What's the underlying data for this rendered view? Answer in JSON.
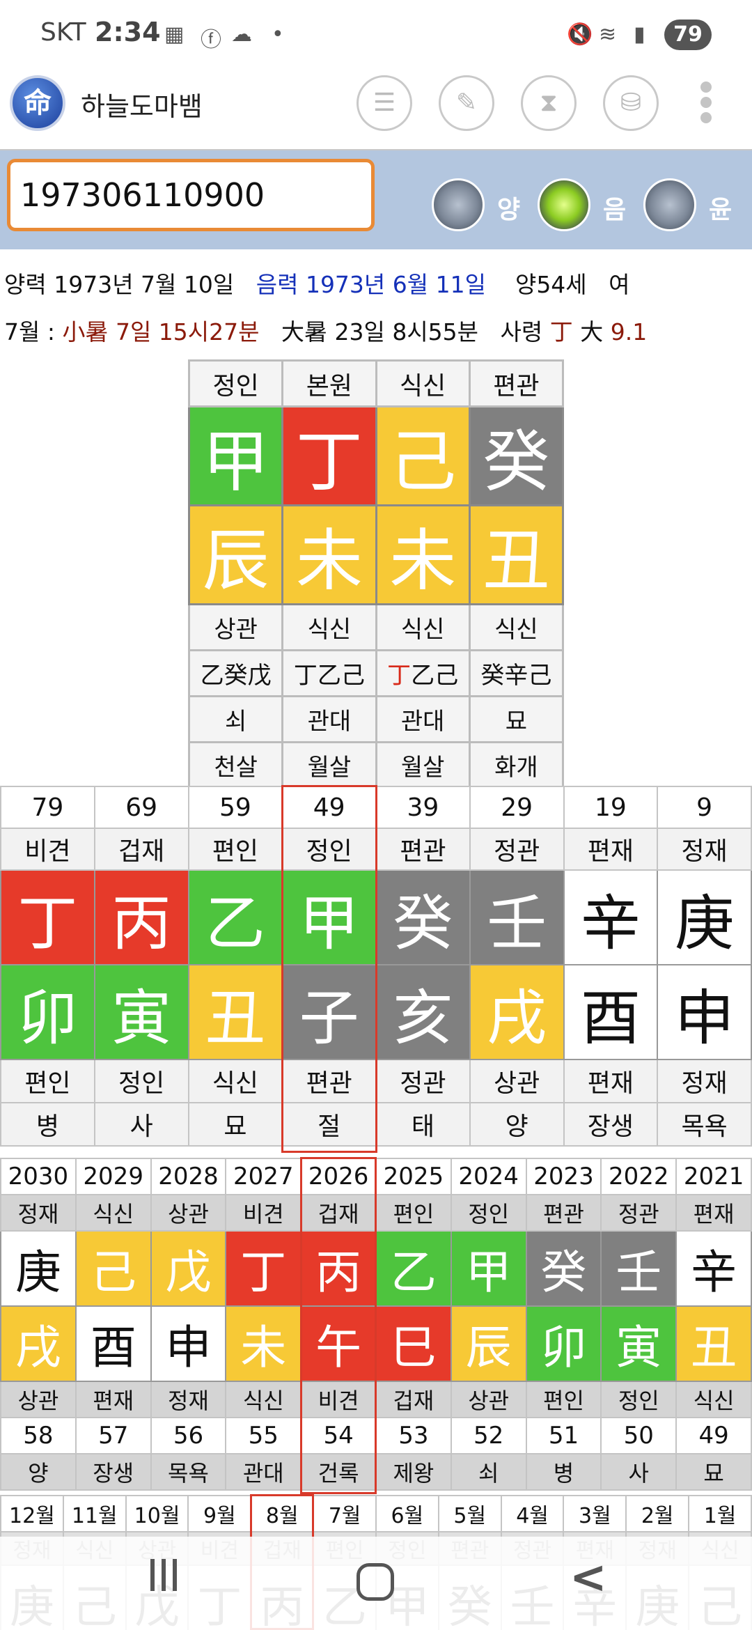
{
  "status_bar": {
    "carrier": "SKT",
    "time": "2:34",
    "battery": "79"
  },
  "app": {
    "title": "하늘도마뱀",
    "logo": "命",
    "toolbar_icons": [
      "list-icon",
      "edit-icon",
      "hourglass-icon",
      "database-icon",
      "more-icon"
    ]
  },
  "input": {
    "value": "197306110900",
    "radios": [
      {
        "label": "양",
        "selected": false
      },
      {
        "label": "음",
        "selected": true
      },
      {
        "label": "윤",
        "selected": false
      }
    ]
  },
  "info": {
    "solar": "양력 1973년 7월 10일",
    "lunar": "음력 1973년 6월 11일",
    "age": "양54세",
    "gender": "여",
    "month_prefix": "7월 :",
    "term1": "小暑 7일 15시27분",
    "term2": "大暑 23일 8시55분",
    "saryeong_label": "사령",
    "saryeong_char": "丁",
    "daeun_label": "大",
    "daeun_num": "9.1"
  },
  "saju": {
    "top_labels": [
      "정인",
      "본원",
      "식신",
      "편관"
    ],
    "stems": [
      {
        "char": "甲",
        "el": "wood"
      },
      {
        "char": "丁",
        "el": "fire"
      },
      {
        "char": "己",
        "el": "earth"
      },
      {
        "char": "癸",
        "el": "water"
      }
    ],
    "branches": [
      {
        "char": "辰",
        "el": "earth"
      },
      {
        "char": "未",
        "el": "earth"
      },
      {
        "char": "未",
        "el": "earth"
      },
      {
        "char": "丑",
        "el": "earth"
      }
    ],
    "branch_labels": [
      "상관",
      "식신",
      "식신",
      "식신"
    ],
    "hidden_stems": [
      {
        "red": "",
        "text": "乙癸戊"
      },
      {
        "red": "",
        "text": "丁乙己"
      },
      {
        "red": "丁",
        "text": "乙己"
      },
      {
        "red": "",
        "text": "癸辛己"
      }
    ],
    "stages": [
      "쇠",
      "관대",
      "관대",
      "묘"
    ],
    "spirits": [
      "천살",
      "월살",
      "월살",
      "화개"
    ]
  },
  "daeun": {
    "ages": [
      "79",
      "69",
      "59",
      "49",
      "39",
      "29",
      "19",
      "9"
    ],
    "stem_labels": [
      "비견",
      "겁재",
      "편인",
      "정인",
      "편관",
      "정관",
      "편재",
      "정재"
    ],
    "stems": [
      {
        "char": "丁",
        "el": "fire"
      },
      {
        "char": "丙",
        "el": "fire"
      },
      {
        "char": "乙",
        "el": "wood"
      },
      {
        "char": "甲",
        "el": "wood"
      },
      {
        "char": "癸",
        "el": "water"
      },
      {
        "char": "壬",
        "el": "water"
      },
      {
        "char": "辛",
        "el": "metal"
      },
      {
        "char": "庚",
        "el": "metal"
      }
    ],
    "branches": [
      {
        "char": "卯",
        "el": "wood"
      },
      {
        "char": "寅",
        "el": "wood"
      },
      {
        "char": "丑",
        "el": "earth"
      },
      {
        "char": "子",
        "el": "water"
      },
      {
        "char": "亥",
        "el": "water"
      },
      {
        "char": "戌",
        "el": "earth"
      },
      {
        "char": "酉",
        "el": "metal"
      },
      {
        "char": "申",
        "el": "metal"
      }
    ],
    "branch_labels": [
      "편인",
      "정인",
      "식신",
      "편관",
      "정관",
      "상관",
      "편재",
      "정재"
    ],
    "stages": [
      "병",
      "사",
      "묘",
      "절",
      "태",
      "양",
      "장생",
      "목욕"
    ]
  },
  "seun": {
    "years": [
      "2030",
      "2029",
      "2028",
      "2027",
      "2026",
      "2025",
      "2024",
      "2023",
      "2022",
      "2021"
    ],
    "stem_labels": [
      "정재",
      "식신",
      "상관",
      "비견",
      "겁재",
      "편인",
      "정인",
      "편관",
      "정관",
      "편재"
    ],
    "stems": [
      {
        "char": "庚",
        "el": "metal"
      },
      {
        "char": "己",
        "el": "earth"
      },
      {
        "char": "戊",
        "el": "earth"
      },
      {
        "char": "丁",
        "el": "fire"
      },
      {
        "char": "丙",
        "el": "fire"
      },
      {
        "char": "乙",
        "el": "wood"
      },
      {
        "char": "甲",
        "el": "wood"
      },
      {
        "char": "癸",
        "el": "water"
      },
      {
        "char": "壬",
        "el": "water"
      },
      {
        "char": "辛",
        "el": "metal"
      }
    ],
    "branches": [
      {
        "char": "戌",
        "el": "earth"
      },
      {
        "char": "酉",
        "el": "metal"
      },
      {
        "char": "申",
        "el": "metal"
      },
      {
        "char": "未",
        "el": "earth"
      },
      {
        "char": "午",
        "el": "fire"
      },
      {
        "char": "巳",
        "el": "fire"
      },
      {
        "char": "辰",
        "el": "earth"
      },
      {
        "char": "卯",
        "el": "wood"
      },
      {
        "char": "寅",
        "el": "wood"
      },
      {
        "char": "丑",
        "el": "earth"
      }
    ],
    "branch_labels": [
      "상관",
      "편재",
      "정재",
      "식신",
      "비견",
      "겁재",
      "상관",
      "편인",
      "정인",
      "식신"
    ],
    "ages": [
      "58",
      "57",
      "56",
      "55",
      "54",
      "53",
      "52",
      "51",
      "50",
      "49"
    ],
    "stages": [
      "양",
      "장생",
      "목욕",
      "관대",
      "건록",
      "제왕",
      "쇠",
      "병",
      "사",
      "묘"
    ]
  },
  "wolun": {
    "months": [
      "12월",
      "11월",
      "10월",
      "9월",
      "8월",
      "7월",
      "6월",
      "5월",
      "4월",
      "3월",
      "2월",
      "1월"
    ],
    "labels": [
      "정재",
      "식신",
      "상관",
      "비견",
      "겁재",
      "편인",
      "정인",
      "편관",
      "정관",
      "편재",
      "정재",
      "식신"
    ],
    "stems": [
      "庚",
      "己",
      "戊",
      "丁",
      "丙",
      "乙",
      "甲",
      "癸",
      "壬",
      "辛",
      "庚",
      "己"
    ]
  }
}
